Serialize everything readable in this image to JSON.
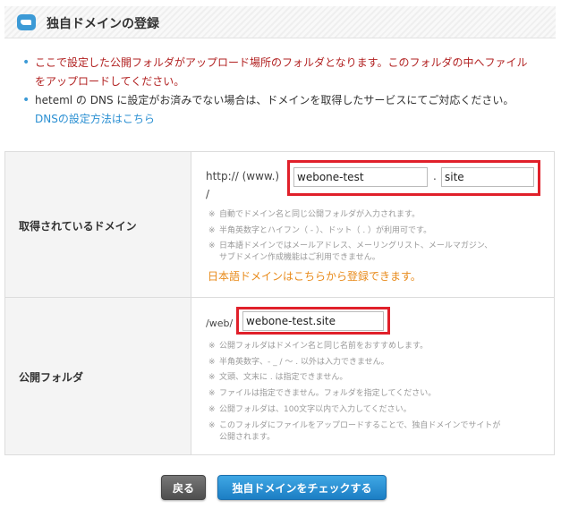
{
  "header": {
    "title": "独自ドメインの登録",
    "icon": "cloud-icon"
  },
  "notes": {
    "note1_line1": "ここで設定した公開フォルダがアップロード場所のフォルダとなります。このフォルダの中へファイル",
    "note1_line2": "をアップロードしてください。",
    "note2": "heteml の DNS に設定がお済みでない場合は、ドメインを取得したサービスにてご対応ください。",
    "dns_link": "DNSの設定方法はこちら"
  },
  "domain_row": {
    "label": "取得されているドメイン",
    "prefix": "http:// (www.)",
    "name_value": "webone-test",
    "dot": ".",
    "tld_value": "site",
    "slash": "/",
    "hints": [
      "自動でドメイン名と同じ公開フォルダが入力されます。",
      "半角英数字とハイフン（ - ）、ドット（ . ）が利用可です。",
      "日本語ドメインではメールアドレス、メーリングリスト、メールマガジン、",
      "サブドメイン作成機能はご利用できません。"
    ],
    "jp_domain_link": "日本語ドメインはこちらから登録できます。"
  },
  "folder_row": {
    "label": "公開フォルダ",
    "prefix": "/web/",
    "folder_value": "webone-test.site",
    "hints": [
      "公開フォルダはドメイン名と同じ名前をおすすめします。",
      "半角英数字、- _ / ～ . 以外は入力できません。",
      "文頭、文末に . は指定できません。",
      "ファイルは指定できません。フォルダを指定してください。",
      "公開フォルダは、100文字以内で入力してください。",
      "このフォルダにファイルをアップロードすることで、独自ドメインでサイトが",
      "公開されます。"
    ],
    "hint_mark": "※"
  },
  "buttons": {
    "back": "戻る",
    "check": "独自ドメインをチェックする"
  },
  "colors": {
    "accent": "#3c9ad6",
    "highlight": "#e0202a",
    "warning_text": "#b22222",
    "link_orange": "#e88a1a"
  }
}
